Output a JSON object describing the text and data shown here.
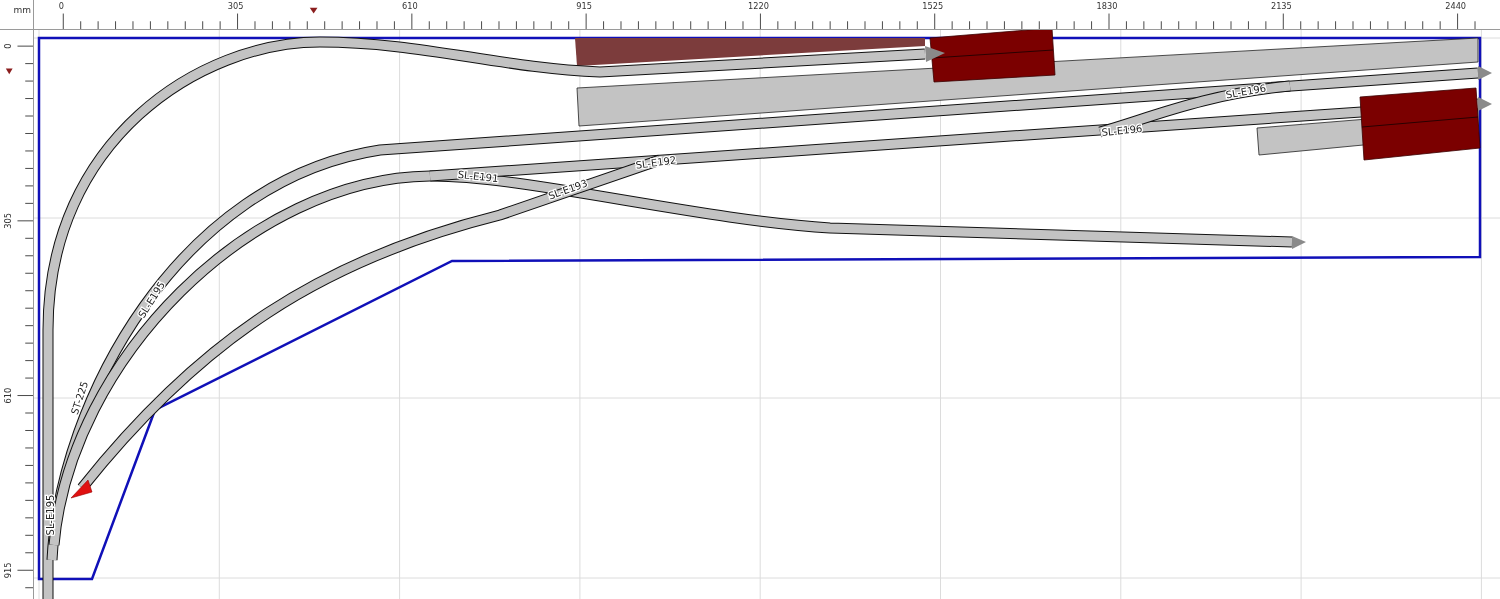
{
  "ruler": {
    "unit": "mm",
    "x_ticks": [
      "0",
      "305",
      "610",
      "915",
      "1220",
      "1525",
      "1830",
      "2135",
      "2440"
    ],
    "y_ticks": [
      "0",
      "305",
      "610",
      "915"
    ]
  },
  "track_labels": [
    "SL-E191",
    "SL-E192",
    "SL-E193",
    "SL-E196",
    "SL-E196",
    "SL-E195",
    "ST-225",
    "SL-E195"
  ]
}
